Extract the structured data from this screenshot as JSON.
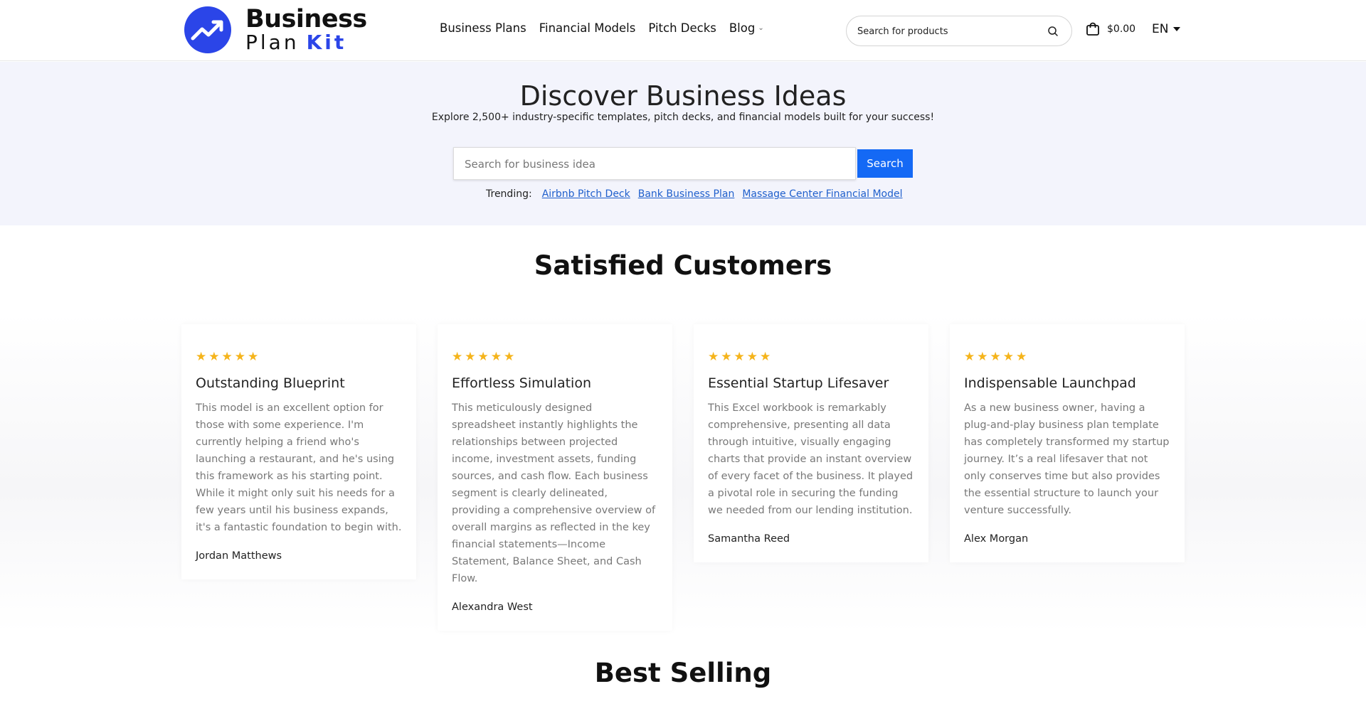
{
  "header": {
    "logo": {
      "line1": "Business",
      "line2": "Plan",
      "line2_accent": "Kit"
    },
    "nav": [
      {
        "label": "Business Plans"
      },
      {
        "label": "Financial Models"
      },
      {
        "label": "Pitch Decks"
      },
      {
        "label": "Blog",
        "has_dropdown": true
      }
    ],
    "search": {
      "placeholder": "Search for products",
      "icon": "search-icon"
    },
    "cart": {
      "icon": "shopping-bag-icon",
      "total": "$0.00"
    },
    "language": "EN"
  },
  "hero": {
    "title": "Discover Business Ideas",
    "subtitle": "Explore 2,500+ industry-specific templates, pitch decks, and financial models built for your success!",
    "search_placeholder": "Search for business idea",
    "search_button": "Search",
    "trending_label": "Trending:",
    "trending": [
      "Airbnb Pitch Deck",
      "Bank Business Plan",
      "Massage Center Financial Model"
    ]
  },
  "customers": {
    "title": "Satisfied Customers",
    "rating_stars": 5,
    "reviews": [
      {
        "title": "Outstanding Blueprint",
        "body": "This model is an excellent option for those with some experience. I'm currently helping a friend who's launching a restaurant, and he's using this framework as his starting point. While it might only suit his needs for a few years until his business expands, it's a fantastic foundation to begin with.",
        "author": "Jordan Matthews"
      },
      {
        "title": "Effortless Simulation",
        "body": "This meticulously designed spreadsheet instantly highlights the relationships between projected income, investment assets, funding sources, and cash flow. Each business segment is clearly delineated, providing a comprehensive overview of overall margins as reflected in the key financial statements—Income Statement, Balance Sheet, and Cash Flow.",
        "author": "Alexandra West"
      },
      {
        "title": "Essential Startup Lifesaver",
        "body": "This Excel workbook is remarkably comprehensive, presenting all data through intuitive, visually engaging charts that provide an instant overview of every facet of the business. It played a pivotal role in securing the funding we needed from our lending institution.",
        "author": "Samantha Reed"
      },
      {
        "title": "Indispensable Launchpad",
        "body": "As a new business owner, having a plug-and-play business plan template has completely transformed my startup journey. It’s a real lifesaver that not only conserves time but also provides the essential structure to launch your venture successfully.",
        "author": "Alex Morgan"
      }
    ]
  },
  "best_selling": {
    "title": "Best Selling"
  },
  "colors": {
    "brand_blue": "#2b45e8",
    "button_blue": "#1469f5",
    "link_blue": "#1f5fcc",
    "star_gold": "#f5b41b",
    "hero_bg": "#f3f4fc"
  }
}
